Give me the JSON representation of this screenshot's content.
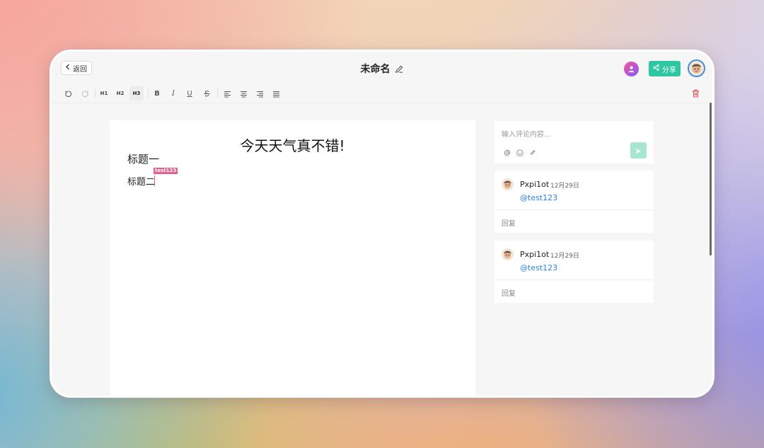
{
  "header": {
    "back_label": "返回",
    "title": "未命名",
    "share_label": "分享"
  },
  "toolbar": {
    "undo_icon": "undo-icon",
    "redo_icon": "redo-icon",
    "h1": "H1",
    "h2": "H2",
    "h3": "H3",
    "bold": "B",
    "italic": "I",
    "underline": "U",
    "delete_icon": "trash-icon",
    "delete_color": "#e5484d"
  },
  "editor": {
    "title": "今天天气真不错!",
    "heading1": "标题一",
    "heading2": "标题二",
    "cursor_user": "test123",
    "cursor_color": "#e0638b"
  },
  "comment_input": {
    "placeholder": "输入评论内容...",
    "icons": [
      "at-icon",
      "emoji-icon",
      "paperclip-icon"
    ]
  },
  "comments": [
    {
      "author": "Pxpi1ot",
      "date": "12月29日",
      "mention": "@test123",
      "reply_label": "回复"
    },
    {
      "author": "Pxpi1ot",
      "date": "12月29日",
      "mention": "@test123",
      "reply_label": "回复"
    }
  ],
  "colors": {
    "accent": "#2ec7a1",
    "mention": "#2a84e6"
  }
}
